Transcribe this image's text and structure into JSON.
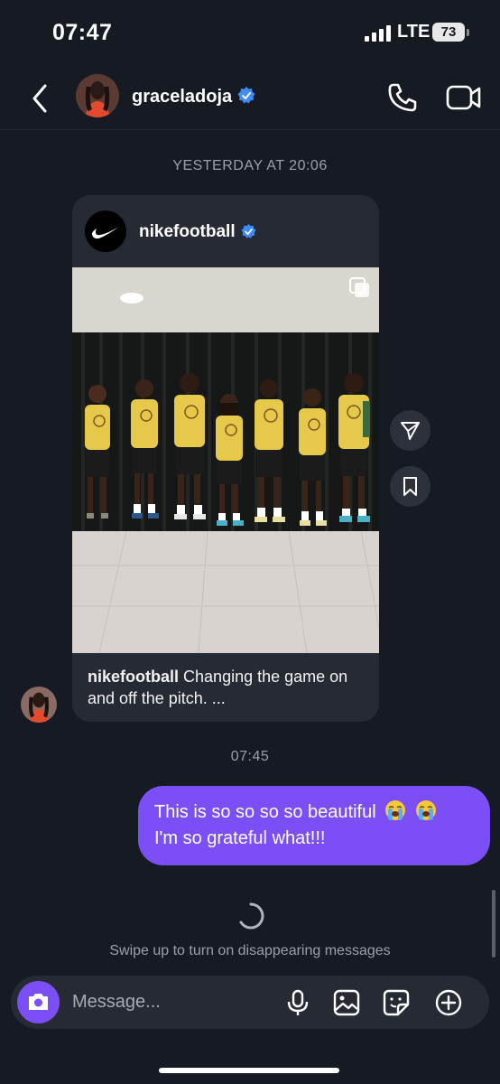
{
  "status_bar": {
    "time": "07:47",
    "network": "LTE",
    "battery": "73"
  },
  "header": {
    "username": "graceladoja",
    "verified": true
  },
  "conversation": {
    "timestamp_1": "YESTERDAY AT 20:06",
    "shared_post": {
      "author": "nikefootball",
      "verified": true,
      "caption_author": "nikefootball",
      "caption_text": "Changing the game on and off the pitch. ..."
    },
    "timestamp_2": "07:45",
    "outgoing_message": {
      "line1": "This is so so so so beautiful",
      "line2": "I'm so grateful what!!!",
      "emoji": "loudly-crying-face"
    },
    "disappearing_hint": "Swipe up to turn on disappearing messages"
  },
  "composer": {
    "placeholder": "Message..."
  },
  "colors": {
    "background": "#161a23",
    "bubble_outgoing": "#7b4ff5",
    "card": "#262a34",
    "verified": "#3d8df5",
    "jersey": "#e6c94a"
  }
}
